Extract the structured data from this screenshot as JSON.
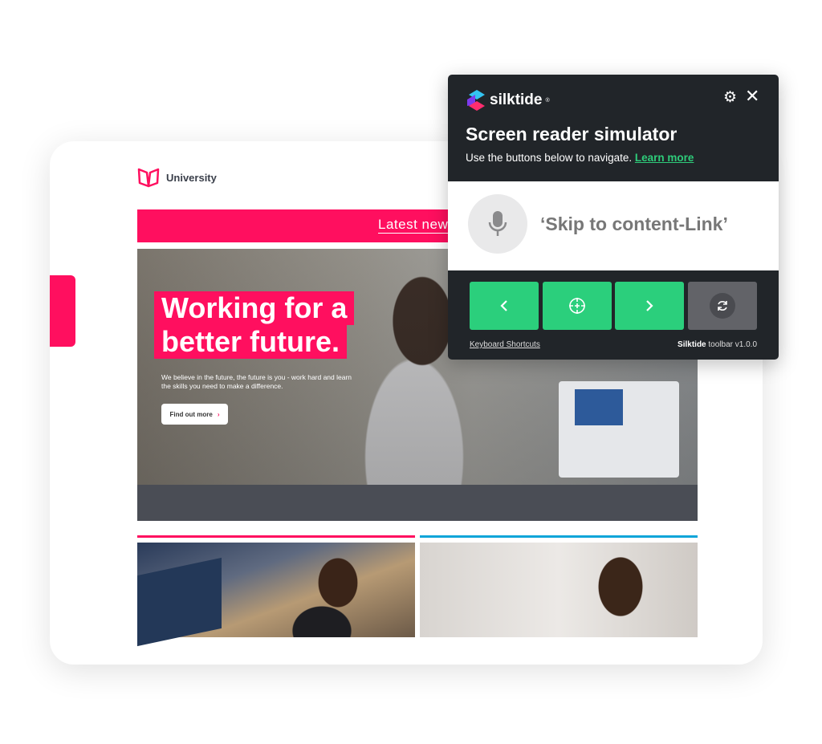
{
  "site": {
    "logo_text": "University",
    "banner_link": "Latest news",
    "headline_line1": "Working for a",
    "headline_line2": "better future.",
    "subtext": "We believe in the future, the future is you - work hard and learn the skills you need to make a difference.",
    "cta": "Find out more",
    "accent": "#ff0f5f",
    "secondary": "#0ea5d9"
  },
  "panel": {
    "brand": "silktide",
    "trademark": "®",
    "title": "Screen reader simulator",
    "description": "Use the buttons below to navigate.",
    "learn_more": "Learn more",
    "spoken_text": "‘Skip to content-Link’",
    "buttons": [
      {
        "icon": "chevron-left-icon"
      },
      {
        "icon": "crosshair-icon"
      },
      {
        "icon": "chevron-right-icon"
      },
      {
        "icon": "refresh-icon"
      }
    ],
    "keyboard_shortcuts": "Keyboard Shortcuts",
    "version_brand": "Silktide",
    "version_text": " toolbar v1.0.0",
    "button_color": "#2bcf7c",
    "bg_color": "#212529"
  }
}
